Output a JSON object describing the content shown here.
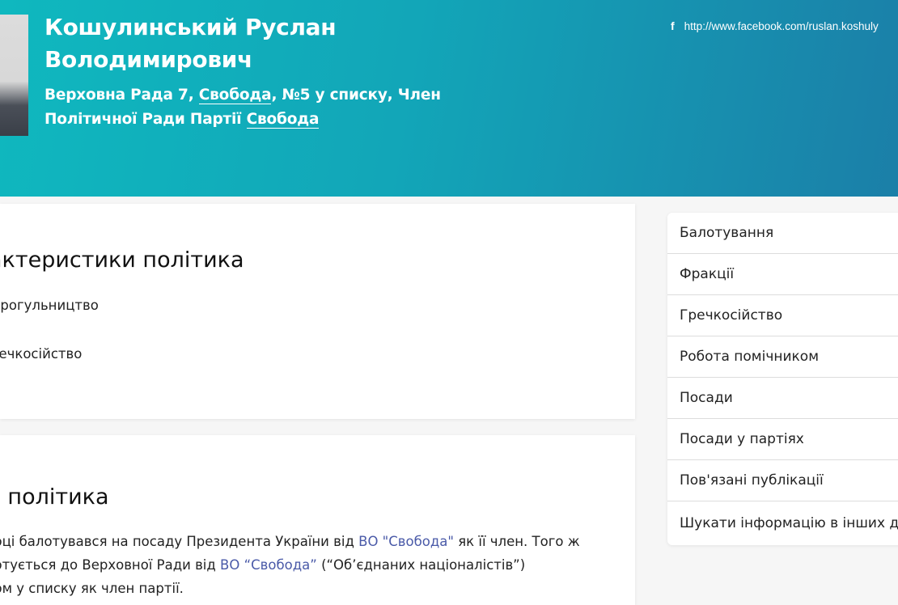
{
  "header": {
    "name_line1": "Кошулинський Руслан",
    "name_line2": "Володимирович",
    "desc_part1": "Верховна Рада 7, ",
    "desc_link1": "Свобода",
    "desc_part2": ", №5 у списку, Член Політичної Ради Партії ",
    "desc_link2": "Свобода",
    "facebook_icon": "f",
    "facebook_url": "http://www.facebook.com/ruslan.koshuly"
  },
  "traits_card": {
    "title": "актеристики політика",
    "items": [
      "Прогульництво",
      "речкосійство"
    ]
  },
  "bio_card": {
    "title": "с політика",
    "line1_a": "році балотувався на посаду Президента України від ",
    "line1_link": "ВО \"Свобода\"",
    "line1_b": " як її член. Того ж",
    "line2_a": "лотується до Верховної Ради від ",
    "line2_link": "ВО “Свобода”",
    "line2_b": " (“Об’єднаних націоналістів”)",
    "line3": "ром у списку як член партії."
  },
  "side_nav": {
    "items": [
      "Балотування",
      "Фракції",
      "Гречкосійство",
      "Робота помічником",
      "Посади",
      "Посади у партіях",
      "Пов'язані публікації",
      "Шукати інформацію в інших дж"
    ]
  },
  "colors": {
    "hero_start": "#0fb8bf",
    "hero_end": "#1b7fa8",
    "link": "#4a5aa8"
  }
}
